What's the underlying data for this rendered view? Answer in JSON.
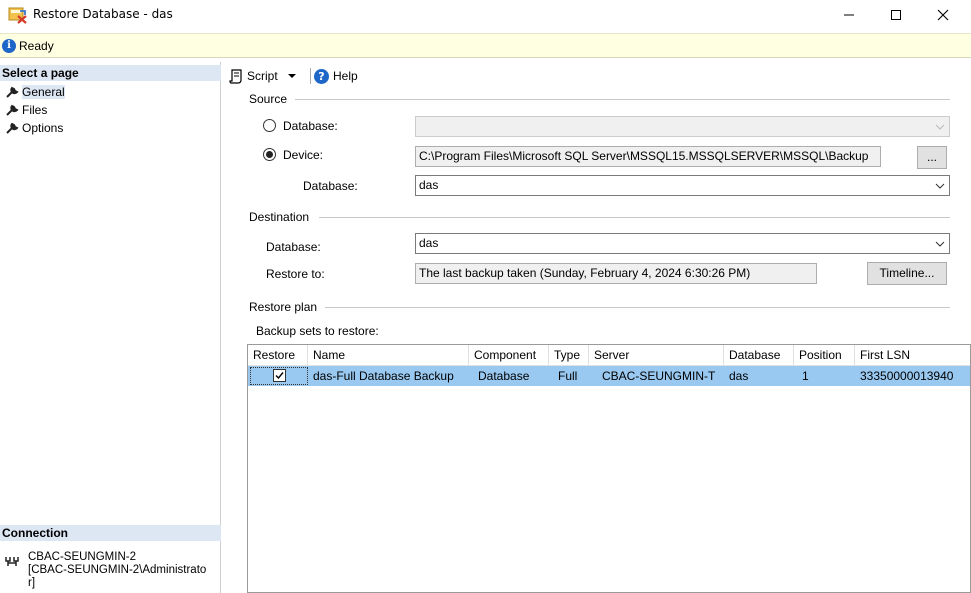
{
  "window": {
    "title": "Restore Database - das"
  },
  "status": {
    "text": "Ready"
  },
  "left_pane": {
    "select_page_header": "Select a page",
    "pages": [
      {
        "label": "General",
        "selected": true
      },
      {
        "label": "Files",
        "selected": false
      },
      {
        "label": "Options",
        "selected": false
      }
    ],
    "connection_header": "Connection",
    "connection_lines": [
      "CBAC-SEUNGMIN-2",
      "[CBAC-SEUNGMIN-2\\Administrato",
      "r]"
    ]
  },
  "toolbar": {
    "script_label": "Script",
    "help_label": "Help"
  },
  "source": {
    "group_label": "Source",
    "database_radio_label": "Database:",
    "database_value": "",
    "device_radio_label": "Device:",
    "device_path": "C:\\Program Files\\Microsoft SQL Server\\MSSQL15.MSSQLSERVER\\MSSQL\\Backup",
    "browse_label": "...",
    "sub_database_label": "Database:",
    "sub_database_value": "das",
    "selected_option": "device"
  },
  "destination": {
    "group_label": "Destination",
    "database_label": "Database:",
    "database_value": "das",
    "restore_to_label": "Restore to:",
    "restore_to_value": "The last backup taken (Sunday, February 4, 2024 6:30:26 PM)",
    "timeline_label": "Timeline..."
  },
  "restore_plan": {
    "group_label": "Restore plan",
    "backup_sets_label": "Backup sets to restore:",
    "columns": [
      "Restore",
      "Name",
      "Component",
      "Type",
      "Server",
      "Database",
      "Position",
      "First LSN"
    ],
    "rows": [
      {
        "restore": true,
        "name": "das-Full Database Backup",
        "component": "Database",
        "type": "Full",
        "server": "CBAC-SEUNGMIN-T",
        "database": "das",
        "position": "1",
        "first_lsn": "33350000013940"
      }
    ]
  },
  "colors": {
    "status_bg": "#ffffe1",
    "section_header_bg": "#dde6f3",
    "selected_row_bg": "#99c8f0",
    "accent_blue": "#1e66c8"
  },
  "icons": {
    "app": "restore-database-icon",
    "info": "info-icon",
    "page": "wrench-icon",
    "script": "script-icon",
    "help": "help-icon",
    "connection": "connection-icon"
  }
}
